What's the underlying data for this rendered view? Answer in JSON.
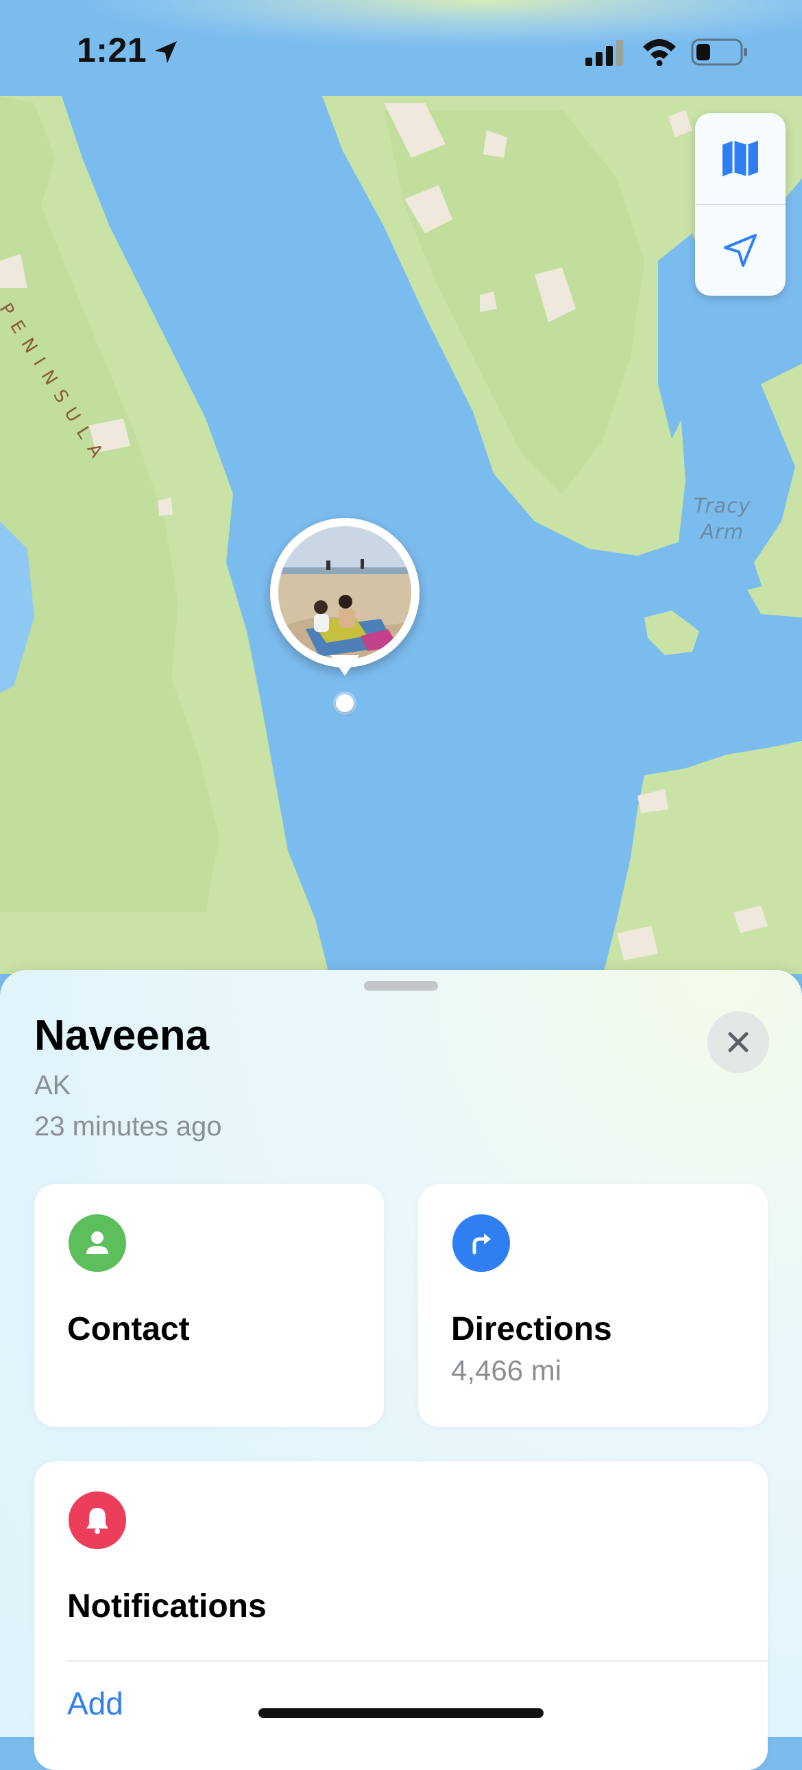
{
  "status_bar": {
    "time": "1:21",
    "icons": [
      "location-arrow-icon",
      "cellular-signal-icon",
      "wifi-icon",
      "battery-icon"
    ]
  },
  "map": {
    "labels": {
      "peninsula": "S PENINSULA",
      "tracy_line1": "Tracy",
      "tracy_line2": "Arm"
    },
    "controls": [
      "map-mode-icon",
      "current-location-icon"
    ]
  },
  "person": {
    "name": "Naveena",
    "region": "AK",
    "last_seen": "23 minutes ago"
  },
  "actions": {
    "contact_label": "Contact",
    "directions_label": "Directions",
    "directions_distance": "4,466 mi"
  },
  "notifications": {
    "title": "Notifications",
    "add_label": "Add"
  },
  "colors": {
    "water": "#7bbcef",
    "land": "#c9e3a6",
    "contact_icon": "#5cbf5c",
    "directions_icon": "#2f7ff3",
    "notifications_icon": "#ec3d5a",
    "link": "#2f7ff3"
  }
}
